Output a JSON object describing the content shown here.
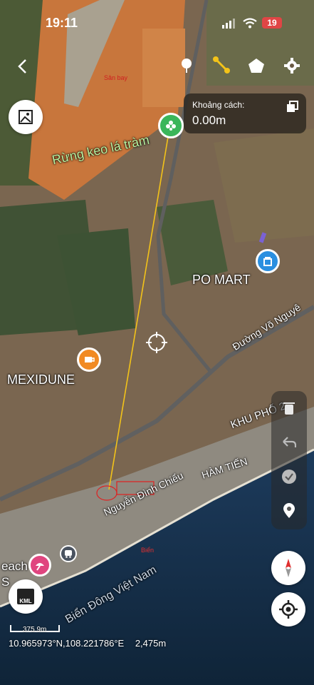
{
  "status_bar": {
    "time": "19:11",
    "battery": "19"
  },
  "map_labels": {
    "rung_keo": "Rừng keo lá tràm",
    "po_mart": "PO MART",
    "mexidune": "MEXIDUNE",
    "duong_vo_nguyen": "Đường Võ Nguyê",
    "khu_pho": "KHU PHỐ 2",
    "ham_tien": "HÀM TIẾN",
    "nguyen_dinh_chieu": "Nguyễn Đình Chiểu",
    "bien_dong": "Biển Đông Việt Nam",
    "bien": "Biển",
    "san_bay": "Sân bay",
    "beach_partial": "each",
    "s_partial": "S"
  },
  "distance_panel": {
    "label": "Khoảng cách:",
    "value": "0.00m"
  },
  "bottom": {
    "coordinates": "10.965973°N,108.221786°E",
    "altitude": "2,475m",
    "scale_label": "375.9m"
  },
  "kml_button": {
    "label": "KML"
  },
  "colors": {
    "yellow_line": "#f3c319",
    "green_poi": "#3ab65a",
    "blue_poi": "#2a8fe0",
    "orange_poi": "#f18a23",
    "pink_poi": "#e0457f"
  }
}
